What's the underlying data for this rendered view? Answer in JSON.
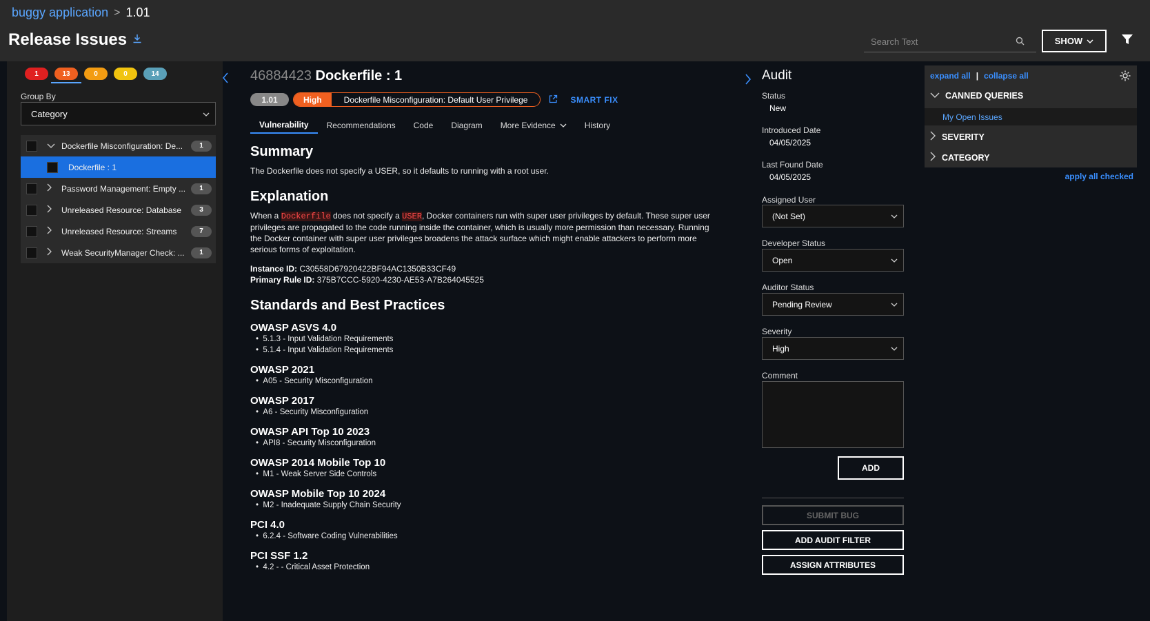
{
  "breadcrumb": {
    "app": "buggy application",
    "sep": ">",
    "version": "1.01"
  },
  "page": {
    "title": "Release Issues",
    "download_icon": "download-icon"
  },
  "search": {
    "placeholder": "Search Text"
  },
  "show_button": {
    "label": "SHOW"
  },
  "severity_badges": [
    {
      "count": "1",
      "color": "#e02020"
    },
    {
      "count": "13",
      "color": "#f06020"
    },
    {
      "count": "0",
      "color": "#f39c12"
    },
    {
      "count": "0",
      "color": "#f1c40f"
    },
    {
      "count": "14",
      "color": "#5aa0b8"
    }
  ],
  "group_by": {
    "label": "Group By",
    "value": "Category"
  },
  "tree": [
    {
      "label": "Dockerfile Misconfiguration: De...",
      "count": "1",
      "expanded": true
    },
    {
      "label": "Dockerfile : 1",
      "selected": true
    },
    {
      "label": "Password Management: Empty ...",
      "count": "1"
    },
    {
      "label": "Unreleased Resource: Database",
      "count": "3"
    },
    {
      "label": "Unreleased Resource: Streams",
      "count": "7"
    },
    {
      "label": "Weak SecurityManager Check: ...",
      "count": "1"
    }
  ],
  "issue": {
    "id": "46884423",
    "title": "Dockerfile : 1",
    "version": "1.01",
    "severity": "High",
    "category": "Dockerfile Misconfiguration: Default User Privilege",
    "smart_fix": "SMART FIX"
  },
  "tabs": [
    "Vulnerability",
    "Recommendations",
    "Code",
    "Diagram",
    "More Evidence",
    "History"
  ],
  "summary": {
    "heading": "Summary",
    "text": "The Dockerfile does not specify a USER, so it defaults to running with a root user."
  },
  "explanation": {
    "heading": "Explanation",
    "p1": "When a ",
    "hl1": "Dockerfile",
    "p2": " does not specify a ",
    "hl2": "USER",
    "p3": ", Docker containers run with super user privileges by default. These super user privileges are propagated to the code running inside the container, which is usually more permission than necessary. Running the Docker container with super user privileges broadens the attack surface which might enable attackers to perform more serious forms of exploitation."
  },
  "ids": {
    "instance_label": "Instance ID:",
    "instance_value": " C30558D67920422BF94AC1350B33CF49",
    "rule_label": "Primary Rule ID:",
    "rule_value": " 375B7CCC-5920-4230-AE53-A7B264045525"
  },
  "standards": {
    "heading": "Standards and Best Practices",
    "groups": [
      {
        "name": "OWASP ASVS 4.0",
        "items": [
          "5.1.3 - Input Validation Requirements",
          "5.1.4 - Input Validation Requirements"
        ]
      },
      {
        "name": "OWASP 2021",
        "items": [
          "A05 - Security Misconfiguration"
        ]
      },
      {
        "name": "OWASP 2017",
        "items": [
          "A6 - Security Misconfiguration"
        ]
      },
      {
        "name": "OWASP API Top 10 2023",
        "items": [
          "API8 - Security Misconfiguration"
        ]
      },
      {
        "name": "OWASP 2014 Mobile Top 10",
        "items": [
          "M1 - Weak Server Side Controls"
        ]
      },
      {
        "name": "OWASP Mobile Top 10 2024",
        "items": [
          "M2 - Inadequate Supply Chain Security"
        ]
      },
      {
        "name": "PCI 4.0",
        "items": [
          "6.2.4 - Software Coding Vulnerabilities"
        ]
      },
      {
        "name": "PCI SSF 1.2",
        "items": [
          "4.2 - - Critical Asset Protection"
        ]
      }
    ]
  },
  "audit": {
    "heading": "Audit",
    "status_label": "Status",
    "status": "New",
    "introduced_label": "Introduced Date",
    "introduced": "04/05/2025",
    "lastfound_label": "Last Found Date",
    "lastfound": "04/05/2025",
    "assigned_label": "Assigned User",
    "assigned": "(Not Set)",
    "devstatus_label": "Developer Status",
    "devstatus": "Open",
    "auditor_label": "Auditor Status",
    "auditor": "Pending Review",
    "severity_label": "Severity",
    "severity": "High",
    "comment_label": "Comment",
    "add": "ADD",
    "submit_bug": "SUBMIT BUG",
    "add_filter": "ADD AUDIT FILTER",
    "assign_attrs": "ASSIGN ATTRIBUTES"
  },
  "filters": {
    "expand_all": "expand all",
    "separator": "|",
    "collapse_all": "collapse all",
    "canned": "CANNED QUERIES",
    "my_open": "My Open Issues",
    "severity": "SEVERITY",
    "category": "CATEGORY",
    "apply": "apply all checked"
  }
}
